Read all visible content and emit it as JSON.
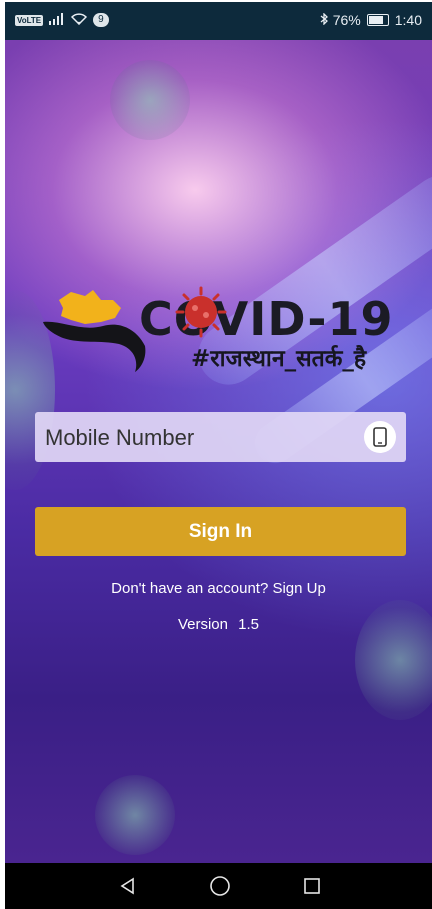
{
  "status_bar": {
    "network_badge": "VoLTE",
    "notification_count": "9",
    "bluetooth_icon": "bluetooth-icon",
    "battery_percent": "76%",
    "time": "1:40"
  },
  "logo": {
    "title": "COVID-19",
    "hashtag": "#राजस्थान_सतर्क_है",
    "brand_colors": {
      "yellow": "#f2b21b",
      "dark": "#1b1b24",
      "virus_red": "#c9302c"
    }
  },
  "form": {
    "mobile_placeholder": "Mobile Number",
    "mobile_value": "",
    "phone_icon": "mobile-phone-icon",
    "sign_in_label": "Sign In",
    "sign_in_color": "#d7a223",
    "signup_prompt": "Don't have an account? Sign Up"
  },
  "footer": {
    "version_label": "Version",
    "version_number": "1.5"
  },
  "nav": {
    "back_icon": "back-triangle-icon",
    "home_icon": "home-circle-icon",
    "recents_icon": "recents-square-icon"
  }
}
